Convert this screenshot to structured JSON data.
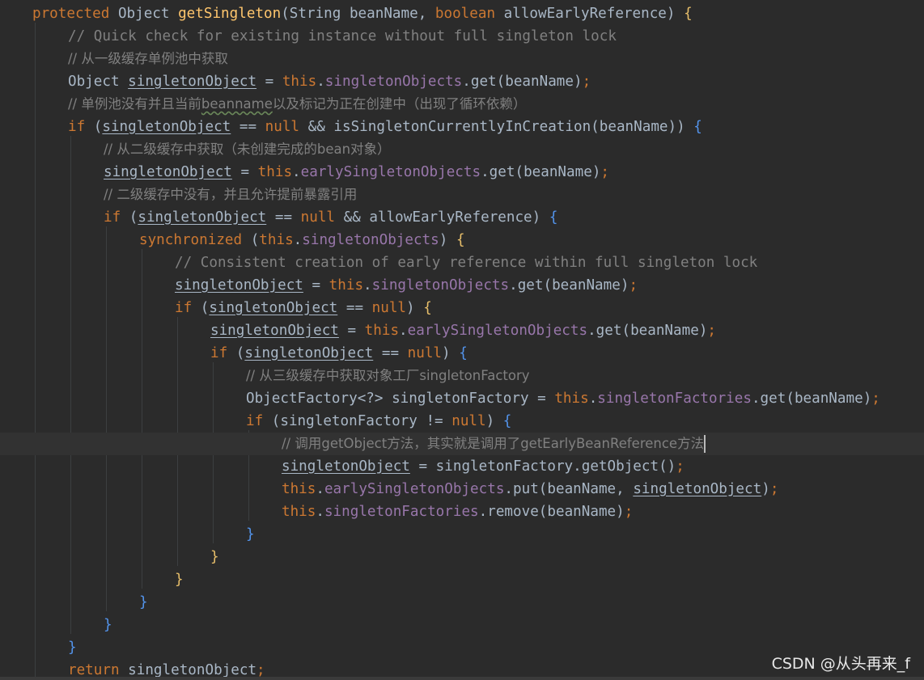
{
  "editor": {
    "lines": [
      [
        [
          "t-kw",
          "protected "
        ],
        [
          "t-type",
          "Object "
        ],
        [
          "t-fn",
          "getSingleton"
        ],
        [
          "t-paren",
          "("
        ],
        [
          "t-type",
          "String "
        ],
        [
          "t-id",
          "beanName"
        ],
        [
          "t-id",
          ", "
        ],
        [
          "t-kw",
          "boolean "
        ],
        [
          "t-id",
          "allowEarlyReference"
        ],
        [
          "t-paren",
          ") "
        ],
        [
          "t-brace-yellow",
          "{"
        ]
      ],
      [
        [
          "t-com",
          "// Quick check for existing instance without full singleton lock"
        ]
      ],
      [
        [
          "t-com-cn",
          "// 从一级缓存单例池中获取"
        ]
      ],
      [
        [
          "t-type",
          "Object "
        ],
        [
          "t-ul",
          "singletonObject"
        ],
        [
          "t-id",
          " = "
        ],
        [
          "t-kw",
          "this"
        ],
        [
          "t-id",
          "."
        ],
        [
          "t-field",
          "singletonObjects"
        ],
        [
          "t-id",
          ".get"
        ],
        [
          "t-paren",
          "("
        ],
        [
          "t-id",
          "beanName"
        ],
        [
          "t-paren",
          ")"
        ],
        [
          "t-kw",
          ";"
        ]
      ],
      [
        [
          "t-com-cn",
          "// 单例池没有并且当前"
        ],
        [
          "t-com-cn t-squiggle",
          "beanname"
        ],
        [
          "t-com-cn",
          "以及标记为正在创建中（出现了循环依赖）"
        ]
      ],
      [
        [
          "t-kw",
          "if "
        ],
        [
          "t-paren",
          "("
        ],
        [
          "t-ul",
          "singletonObject"
        ],
        [
          "t-id",
          " == "
        ],
        [
          "t-kw",
          "null "
        ],
        [
          "t-id",
          "&& isSingletonCurrentlyInCreation"
        ],
        [
          "t-paren",
          "("
        ],
        [
          "t-id",
          "beanName"
        ],
        [
          "t-paren",
          "))"
        ],
        [
          "t-id",
          " "
        ],
        [
          "t-brace-blue",
          "{"
        ]
      ],
      [
        [
          "t-com-cn",
          "// 从二级缓存中获取（未创建完成的bean对象）"
        ]
      ],
      [
        [
          "t-ul",
          "singletonObject"
        ],
        [
          "t-id",
          " = "
        ],
        [
          "t-kw",
          "this"
        ],
        [
          "t-id",
          "."
        ],
        [
          "t-field",
          "earlySingletonObjects"
        ],
        [
          "t-id",
          ".get"
        ],
        [
          "t-paren",
          "("
        ],
        [
          "t-id",
          "beanName"
        ],
        [
          "t-paren",
          ")"
        ],
        [
          "t-kw",
          ";"
        ]
      ],
      [
        [
          "t-com-cn",
          "// 二级缓存中没有，并且允许提前暴露引用"
        ]
      ],
      [
        [
          "t-kw",
          "if "
        ],
        [
          "t-paren",
          "("
        ],
        [
          "t-ul",
          "singletonObject"
        ],
        [
          "t-id",
          " == "
        ],
        [
          "t-kw",
          "null "
        ],
        [
          "t-id",
          "&& allowEarlyReference"
        ],
        [
          "t-paren",
          ") "
        ],
        [
          "t-brace-blue",
          "{"
        ]
      ],
      [
        [
          "t-kw",
          "synchronized "
        ],
        [
          "t-paren",
          "("
        ],
        [
          "t-kw",
          "this"
        ],
        [
          "t-id",
          "."
        ],
        [
          "t-field",
          "singletonObjects"
        ],
        [
          "t-paren",
          ") "
        ],
        [
          "t-brace-yellow",
          "{"
        ]
      ],
      [
        [
          "t-com",
          "// Consistent creation of early reference within full singleton lock"
        ]
      ],
      [
        [
          "t-ul",
          "singletonObject"
        ],
        [
          "t-id",
          " = "
        ],
        [
          "t-kw",
          "this"
        ],
        [
          "t-id",
          "."
        ],
        [
          "t-field",
          "singletonObjects"
        ],
        [
          "t-id",
          ".get"
        ],
        [
          "t-paren",
          "("
        ],
        [
          "t-id",
          "beanName"
        ],
        [
          "t-paren",
          ")"
        ],
        [
          "t-kw",
          ";"
        ]
      ],
      [
        [
          "t-kw",
          "if "
        ],
        [
          "t-paren",
          "("
        ],
        [
          "t-ul",
          "singletonObject"
        ],
        [
          "t-id",
          " == "
        ],
        [
          "t-kw",
          "null"
        ],
        [
          "t-paren",
          ") "
        ],
        [
          "t-brace-yellow",
          "{"
        ]
      ],
      [
        [
          "t-ul",
          "singletonObject"
        ],
        [
          "t-id",
          " = "
        ],
        [
          "t-kw",
          "this"
        ],
        [
          "t-id",
          "."
        ],
        [
          "t-field",
          "earlySingletonObjects"
        ],
        [
          "t-id",
          ".get"
        ],
        [
          "t-paren",
          "("
        ],
        [
          "t-id",
          "beanName"
        ],
        [
          "t-paren",
          ")"
        ],
        [
          "t-kw",
          ";"
        ]
      ],
      [
        [
          "t-kw",
          "if "
        ],
        [
          "t-paren",
          "("
        ],
        [
          "t-ul",
          "singletonObject"
        ],
        [
          "t-id",
          " == "
        ],
        [
          "t-kw",
          "null"
        ],
        [
          "t-paren",
          ") "
        ],
        [
          "t-brace-blue",
          "{"
        ]
      ],
      [
        [
          "t-com-cn",
          "// 从三级缓存中获取对象工厂singletonFactory"
        ]
      ],
      [
        [
          "t-type",
          "ObjectFactory"
        ],
        [
          "t-id",
          "<?> singletonFactory = "
        ],
        [
          "t-kw",
          "this"
        ],
        [
          "t-id",
          "."
        ],
        [
          "t-field",
          "singletonFactories"
        ],
        [
          "t-id",
          ".get"
        ],
        [
          "t-paren",
          "("
        ],
        [
          "t-id",
          "beanName"
        ],
        [
          "t-paren",
          ")"
        ],
        [
          "t-kw",
          ";"
        ]
      ],
      [
        [
          "t-kw",
          "if "
        ],
        [
          "t-paren",
          "("
        ],
        [
          "t-id",
          "singletonFactory != "
        ],
        [
          "t-kw",
          "null"
        ],
        [
          "t-paren",
          ") "
        ],
        [
          "t-brace-blue",
          "{"
        ]
      ],
      [
        [
          "t-com-cn",
          "// 调用getObject方法，其实就是调用了getEarlyBeanReference方法"
        ]
      ],
      [
        [
          "t-ul",
          "singletonObject"
        ],
        [
          "t-id",
          " = singletonFactory.getObject"
        ],
        [
          "t-paren",
          "()"
        ],
        [
          "t-kw",
          ";"
        ]
      ],
      [
        [
          "t-kw",
          "this"
        ],
        [
          "t-id",
          "."
        ],
        [
          "t-field",
          "earlySingletonObjects"
        ],
        [
          "t-id",
          ".put"
        ],
        [
          "t-paren",
          "("
        ],
        [
          "t-id",
          "beanName, "
        ],
        [
          "t-ul",
          "singletonObject"
        ],
        [
          "t-paren",
          ")"
        ],
        [
          "t-kw",
          ";"
        ]
      ],
      [
        [
          "t-kw",
          "this"
        ],
        [
          "t-id",
          "."
        ],
        [
          "t-field",
          "singletonFactories"
        ],
        [
          "t-id",
          ".remove"
        ],
        [
          "t-paren",
          "("
        ],
        [
          "t-id",
          "beanName"
        ],
        [
          "t-paren",
          ")"
        ],
        [
          "t-kw",
          ";"
        ]
      ],
      [
        [
          "t-brace-blue",
          "}"
        ]
      ],
      [
        [
          "t-brace-yellow",
          "}"
        ]
      ],
      [
        [
          "t-brace-yellow",
          "}"
        ]
      ],
      [
        [
          "t-brace-blue",
          "}"
        ]
      ],
      [
        [
          "t-brace-blue",
          "}"
        ]
      ],
      [
        [
          "t-brace-blue",
          "}"
        ]
      ],
      [
        [
          "t-kw",
          "return "
        ],
        [
          "t-ul",
          "singletonObject"
        ],
        [
          "t-kw",
          ";"
        ]
      ]
    ]
  },
  "watermark": {
    "text": "CSDN @从头再来_f"
  }
}
